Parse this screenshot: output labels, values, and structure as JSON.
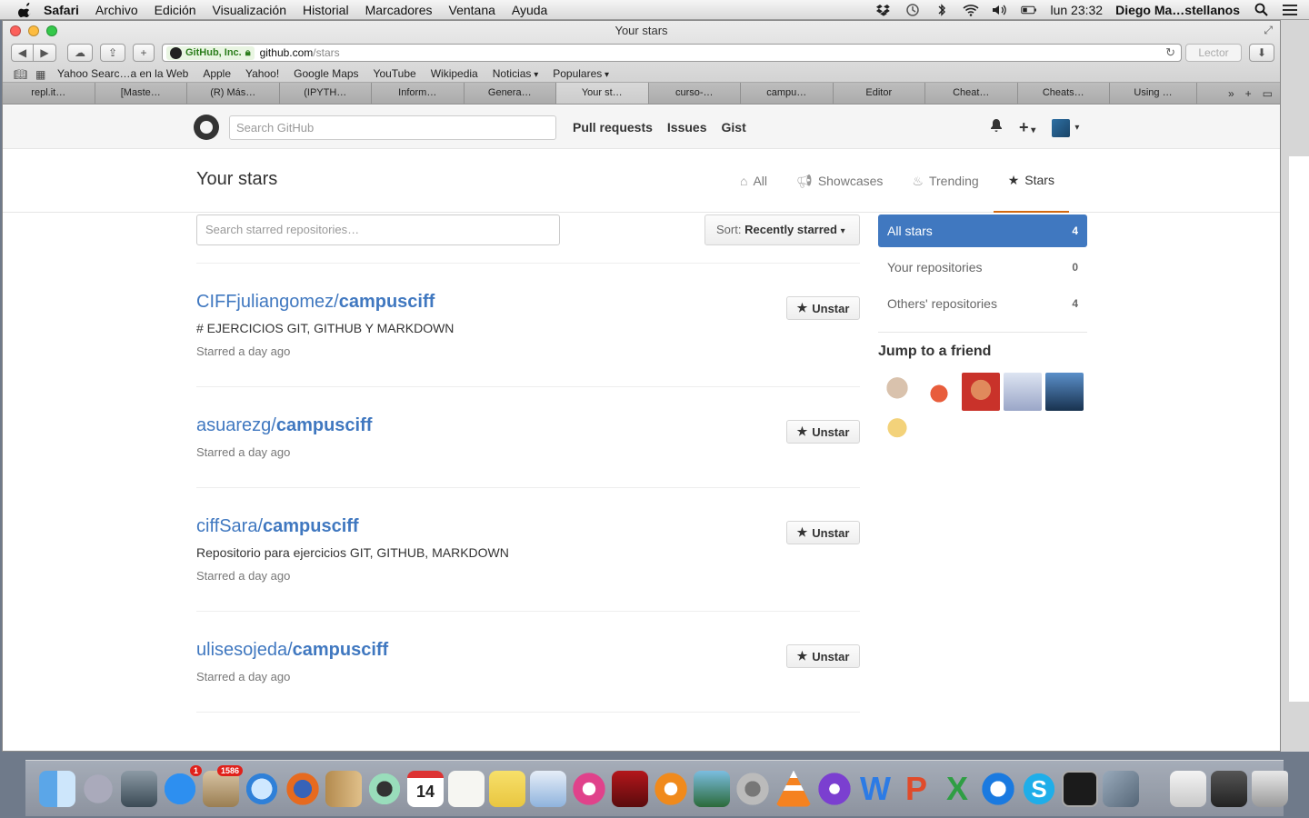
{
  "menubar": {
    "items": [
      "Safari",
      "Archivo",
      "Edición",
      "Visualización",
      "Historial",
      "Marcadores",
      "Ventana",
      "Ayuda"
    ],
    "clock": "lun 23:32",
    "user": "Diego Ma…stellanos"
  },
  "window": {
    "title": "Your stars",
    "ev_label": "GitHub, Inc.",
    "url_host": "github.com",
    "url_path": "/stars",
    "reader_label": "Lector",
    "bookmarks": [
      "Yahoo Searc…a en la Web",
      "Apple",
      "Yahoo!",
      "Google Maps",
      "YouTube",
      "Wikipedia",
      "Noticias",
      "Populares"
    ],
    "tabs": [
      "repl.it…",
      "[Maste…",
      "(R) Más…",
      "(IPYTH…",
      "Inform…",
      "Genera…",
      "Your st…",
      "curso-…",
      "campu…",
      "Editor",
      "Cheat…",
      "Cheats…",
      "Using …"
    ]
  },
  "github": {
    "search_placeholder": "Search GitHub",
    "nav": [
      "Pull requests",
      "Issues",
      "Gist"
    ],
    "page_title": "Your stars",
    "explore_tabs": [
      {
        "label": "All",
        "icon": "home-icon"
      },
      {
        "label": "Showcases",
        "icon": "megaphone-icon"
      },
      {
        "label": "Trending",
        "icon": "flame-icon"
      },
      {
        "label": "Stars",
        "icon": "star-icon"
      }
    ],
    "filter_placeholder": "Search starred repositories…",
    "sort_prefix": "Sort:",
    "sort_value": "Recently starred",
    "repos": [
      {
        "owner": "CIFFjuliangomez/",
        "name": "campusciff",
        "description": "# EJERCICIOS GIT, GITHUB Y MARKDOWN",
        "meta": "Starred a day ago"
      },
      {
        "owner": "asuarezg/",
        "name": "campusciff",
        "description": "",
        "meta": "Starred a day ago"
      },
      {
        "owner": "ciffSara/",
        "name": "campusciff",
        "description": "Repositorio para ejercicios GIT, GITHUB, MARKDOWN",
        "meta": "Starred a day ago"
      },
      {
        "owner": "ulisesojeda/",
        "name": "campusciff",
        "description": "",
        "meta": "Starred a day ago"
      }
    ],
    "unstar_label": "Unstar",
    "filters": [
      {
        "label": "All stars",
        "count": "4"
      },
      {
        "label": "Your repositories",
        "count": "0"
      },
      {
        "label": "Others' repositories",
        "count": "4"
      }
    ],
    "friends_title": "Jump to a friend",
    "accent": "#4078c0",
    "tab_underline": "#d26911"
  },
  "dock": {
    "badges": {
      "appstore": "1",
      "mail": "1586"
    },
    "calendar_day": "14"
  }
}
